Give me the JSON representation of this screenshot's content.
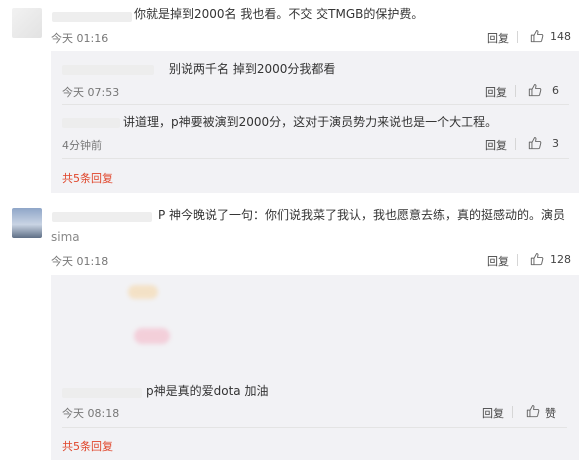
{
  "comments": [
    {
      "text": "你就是掉到2000名 我也看。不交 交TMGB的保护费。",
      "time": "今天 01:16",
      "reply_label": "回复",
      "likes": "148",
      "replies": [
        {
          "text": "别说两千名 掉到2000分我都看",
          "time": "今天 07:53",
          "reply_label": "回复",
          "likes": "6"
        },
        {
          "text": "讲道理，p神要被演到2000分，这对于演员势力来说也是一个大工程。",
          "time": "4分钟前",
          "reply_label": "回复",
          "likes": "3"
        }
      ],
      "expand_label": "共5条回复"
    },
    {
      "text_line1": "P 神今晚说了一句：你们说我菜了我认，我也愿意去练，真的挺感动的。演员",
      "text_line2": "sima",
      "time": "今天 01:18",
      "reply_label": "回复",
      "likes": "128",
      "replies": [
        {
          "text": "p神是真的爱dota  加油",
          "time": "今天 08:18",
          "reply_label": "回复",
          "likes": "赞"
        }
      ],
      "expand_label": "共5条回复"
    }
  ],
  "icons": {
    "like": "thumbs-up-icon"
  },
  "colors": {
    "link_red": "#e0452a",
    "reply_bg": "#f2f2f5",
    "text": "#333333",
    "meta": "#777777"
  }
}
